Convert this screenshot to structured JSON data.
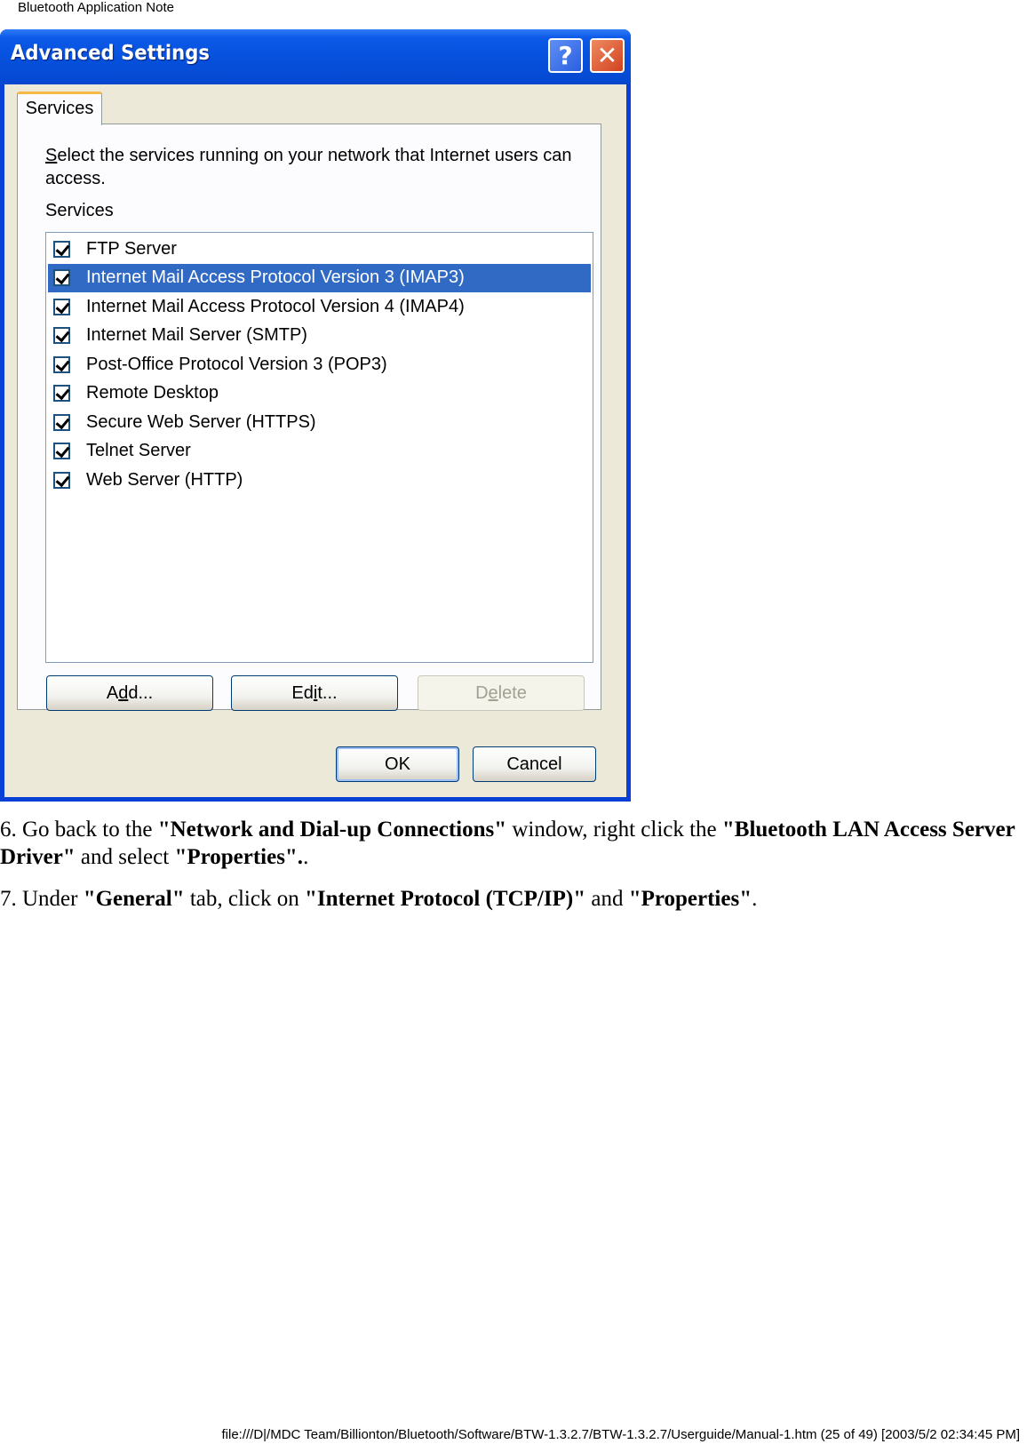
{
  "page": {
    "header": "Bluetooth Application Note",
    "footer": "file:///D|/MDC Team/Billionton/Bluetooth/Software/BTW-1.3.2.7/BTW-1.3.2.7/Userguide/Manual-1.htm (25 of 49) [2003/5/2 02:34:45 PM]"
  },
  "dialog": {
    "title": "Advanced Settings",
    "help_icon": "?",
    "close_icon": "✕",
    "tab_label": "Services",
    "description_first_letter": "S",
    "description_rest": "elect the services running on your network that Internet users can access.",
    "services_label": "Services",
    "services": [
      {
        "label": "FTP Server",
        "checked": true,
        "selected": false
      },
      {
        "label": "Internet Mail Access Protocol Version 3 (IMAP3)",
        "checked": true,
        "selected": true
      },
      {
        "label": "Internet Mail Access Protocol Version 4 (IMAP4)",
        "checked": true,
        "selected": false
      },
      {
        "label": "Internet Mail Server (SMTP)",
        "checked": true,
        "selected": false
      },
      {
        "label": "Post-Office Protocol Version 3 (POP3)",
        "checked": true,
        "selected": false
      },
      {
        "label": "Remote Desktop",
        "checked": true,
        "selected": false
      },
      {
        "label": "Secure Web Server (HTTPS)",
        "checked": true,
        "selected": false
      },
      {
        "label": "Telnet Server",
        "checked": true,
        "selected": false
      },
      {
        "label": "Web Server (HTTP)",
        "checked": true,
        "selected": false
      }
    ],
    "buttons": {
      "add": {
        "pre": "A",
        "mnemonic": "d",
        "post": "d..."
      },
      "edit": {
        "pre": "Ed",
        "mnemonic": "i",
        "post": "t..."
      },
      "delete": {
        "pre": "D",
        "mnemonic": "e",
        "post": "lete"
      },
      "ok": "OK",
      "cancel": "Cancel"
    },
    "colors": {
      "selection": "#316ac5",
      "titlebar": "#0650dc",
      "client_bg": "#ece9d8"
    }
  },
  "instructions": {
    "step6": {
      "t1": "6. Go back to the ",
      "b1": "\"Network and Dial-up Connections\"",
      "t2": " window, right click the ",
      "b2": "\"Bluetooth LAN Access Server Driver\"",
      "t3": " and select ",
      "b3": "\"Properties\".",
      "t4": "."
    },
    "step7": {
      "t1": "7. Under ",
      "b1": "\"General\"",
      "t2": " tab, click on ",
      "b2": "\"Internet Protocol (TCP/IP)\"",
      "t3": " and ",
      "b3": "\"Properties\"",
      "t4": "."
    }
  }
}
